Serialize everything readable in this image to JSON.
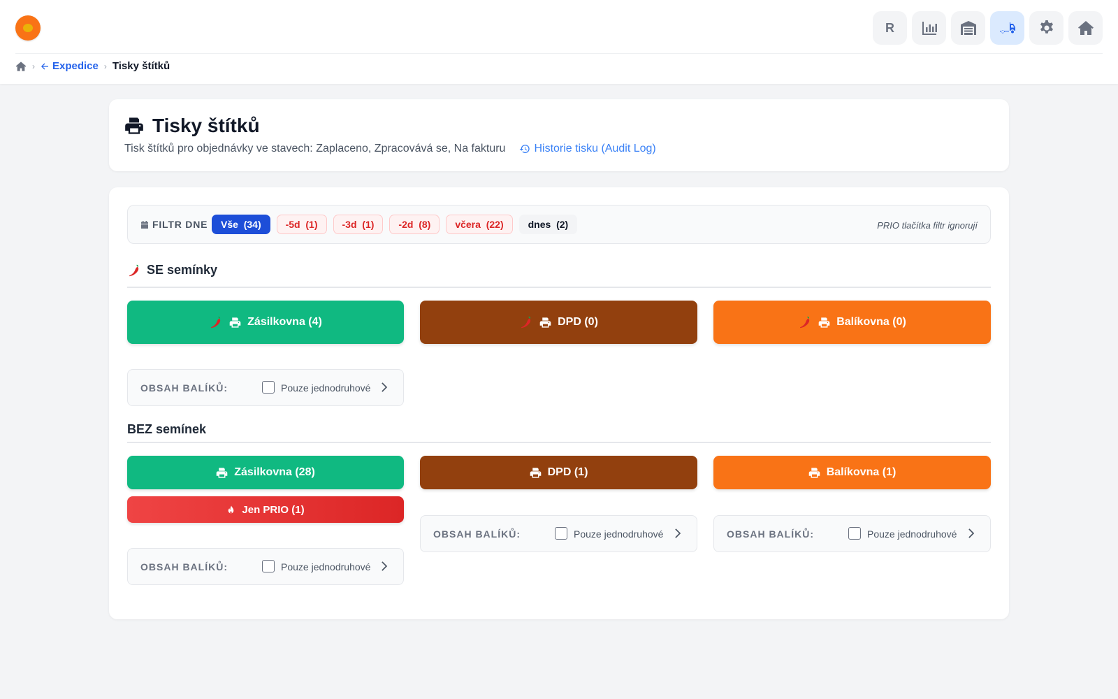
{
  "nav": {
    "user_initial": "R",
    "icons": [
      "chart-icon",
      "warehouse-icon",
      "truck-icon",
      "gear-icon",
      "home-icon"
    ],
    "active": "truck-icon"
  },
  "breadcrumb": {
    "back_label": "Expedice",
    "current": "Tisky štítků"
  },
  "header": {
    "title": "Tisky štítků",
    "subtitle": "Tisk štítků pro objednávky ve stavech: Zaplaceno, Zpracovává se, Na fakturu",
    "audit_link": "Historie tisku (Audit Log)"
  },
  "filter": {
    "label": "FILTR DNE",
    "chips": [
      {
        "label": "Vše",
        "count": "(34)"
      },
      {
        "label": "-5d",
        "count": "(1)"
      },
      {
        "label": "-3d",
        "count": "(1)"
      },
      {
        "label": "-2d",
        "count": "(8)"
      },
      {
        "label": "včera",
        "count": "(22)"
      },
      {
        "label": "dnes",
        "count": "(2)"
      }
    ],
    "note": "PRIO tlačítka filtr ignorují"
  },
  "section_seeds": {
    "title": "SE semínky",
    "zasilkovna": "Zásilkovna (4)",
    "dpd": "DPD (0)",
    "balikovna": "Balíkovna (0)",
    "content_label": "OBSAH BALÍKŮ:",
    "single_variety": "Pouze jednodruhové"
  },
  "section_no_seeds": {
    "title": "BEZ semínek",
    "zasilkovna": "Zásilkovna (28)",
    "dpd": "DPD (1)",
    "balikovna": "Balíkovna (1)",
    "prio": "Jen PRIO (1)",
    "content_label": "OBSAH BALÍKŮ:",
    "single_variety": "Pouze jednodruhové"
  },
  "colors": {
    "zasilkovna": "#10b981",
    "dpd": "#92400e",
    "balikovna": "#f97316",
    "prio": "#dc2626",
    "accent": "#1d4ed8"
  }
}
